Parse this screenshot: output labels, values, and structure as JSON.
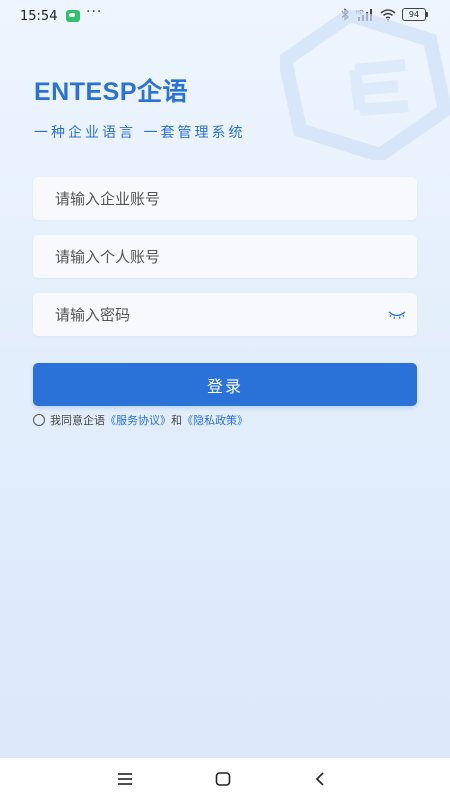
{
  "status_bar": {
    "time": "15:54",
    "icons": [
      "wechat-icon",
      "more-icon",
      "bluetooth-icon",
      "signal-icon",
      "wifi-icon",
      "battery-icon"
    ],
    "more": "···",
    "battery": "94"
  },
  "brand": {
    "name": "ENTESP企语",
    "slogan": "一种企业语言 一套管理系统",
    "color": "#2a72d6"
  },
  "form": {
    "company_account_placeholder": "请输入企业账号",
    "personal_account_placeholder": "请输入个人账号",
    "password_placeholder": "请输入密码"
  },
  "login_button": {
    "label": "登录",
    "color": "#2b72d8"
  },
  "agreement": {
    "prefix": "我同意企语",
    "service_link": "《服务协议》",
    "and": "和",
    "privacy_link": "《隐私政策》"
  },
  "nav_bar": {
    "icons": [
      "menu-icon",
      "home-icon",
      "back-icon"
    ]
  }
}
